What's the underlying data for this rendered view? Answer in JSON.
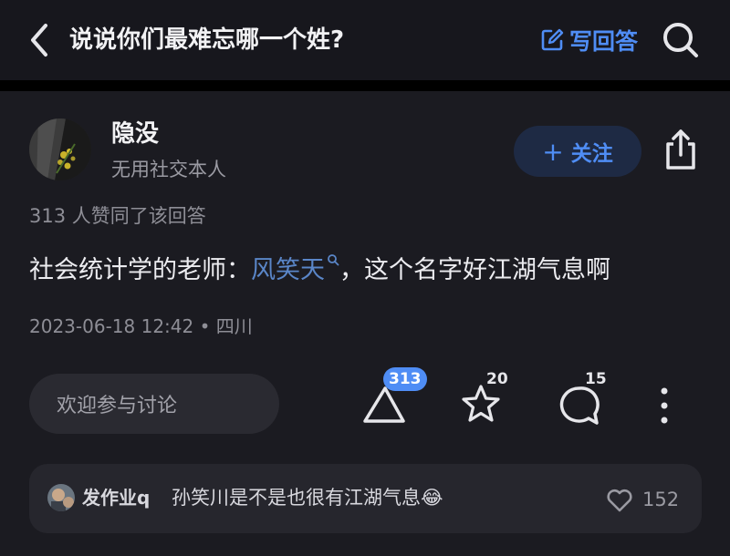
{
  "header": {
    "title": "说说你们最难忘哪一个姓?",
    "write_answer": "写回答",
    "icons": {
      "back": "chevron-left-icon",
      "write": "edit-square-icon",
      "search": "search-icon"
    }
  },
  "author": {
    "name": "隐没",
    "bio": "无用社交本人",
    "follow_label": "关注",
    "follow_plus": "+"
  },
  "answer": {
    "likes_line": "313 人赞同了该回答",
    "text_before": "社会统计学的老师：",
    "link_text": "风笑天",
    "text_after": "，这个名字好江湖气息啊",
    "meta": "2023-06-18 12:42 • 四川"
  },
  "actions": {
    "comment_placeholder": "欢迎参与讨论",
    "vote_count": "313",
    "favorite_count": "20",
    "comment_count": "15"
  },
  "hot_comment": {
    "user": "发作业q",
    "text": "孙笑川是不是也很有江湖气息",
    "emoji": "😂",
    "like_count": "152"
  },
  "colors": {
    "background": "#17171d",
    "card": "#1b1b21",
    "accent": "#4f8df5",
    "link": "#5a86c8",
    "muted": "#8e8e96"
  }
}
